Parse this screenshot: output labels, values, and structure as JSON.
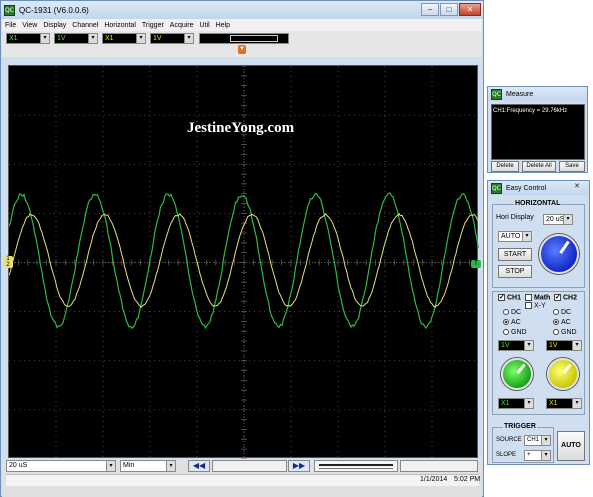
{
  "main": {
    "title": "QC-1931 (V6.0.0.6)",
    "menu": [
      "File",
      "View",
      "Display",
      "Channel",
      "Horizontal",
      "Trigger",
      "Acquire",
      "Util",
      "Help"
    ],
    "toolbar": {
      "sel1": "X1",
      "sel2": "1V",
      "sel3": "X1",
      "sel4": "1V"
    },
    "watermark": "JestineYong.com",
    "ch1_marker": "1",
    "ch2_marker": "2",
    "trig_marker": "T",
    "bottom": {
      "timebase": "20 uS",
      "mode": "Min",
      "date": "1/1/2014",
      "time": "5:02 PM"
    }
  },
  "measure": {
    "title": "Measure",
    "text": "CH1:Frequency = 29.76kHz",
    "delete": "Delete",
    "delete_all": "Delete All",
    "save": "Save"
  },
  "easy": {
    "title": "Easy Control",
    "horizontal": "HORIZONTAL",
    "hori_display": "Hori Display",
    "hori_value": "20 uS",
    "auto_sel": "AUTO",
    "start": "START",
    "stop": "STOP",
    "ch1": "CH1",
    "math": "Math",
    "ch2": "CH2",
    "xy": "X-Y",
    "dc": "DC",
    "ac": "AC",
    "gnd": "GND",
    "ch1_volt": "1V",
    "ch2_volt": "1V",
    "ch1_probe": "X1",
    "ch2_probe": "X1",
    "trigger": "TRIGGER",
    "source": "SOURCE",
    "source_val": "CH1",
    "slope": "SLOPE",
    "slope_val": "+",
    "auto": "AUTO"
  },
  "colors": {
    "ch1": "#e8e07a",
    "ch2": "#2fb84a",
    "grid": "#5a5a5a",
    "screen": "#000000"
  }
}
